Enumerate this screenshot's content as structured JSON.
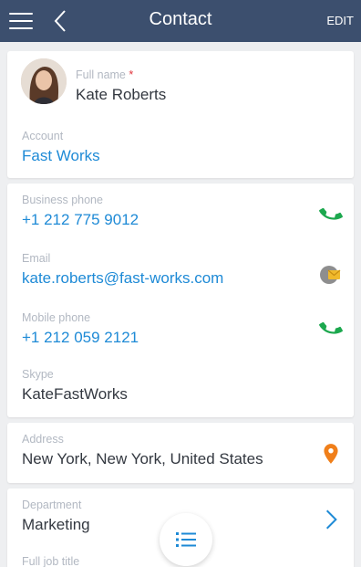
{
  "header": {
    "title": "Contact",
    "edit_label": "EDIT"
  },
  "profile": {
    "full_name_label": "Full name",
    "required_mark": "*",
    "full_name": "Kate Roberts",
    "account_label": "Account",
    "account": "Fast Works"
  },
  "communication": {
    "business_phone_label": "Business phone",
    "business_phone": "+1 212 775 9012",
    "email_label": "Email",
    "email": "kate.roberts@fast-works.com",
    "mobile_phone_label": "Mobile phone",
    "mobile_phone": "+1 212 059 2121",
    "skype_label": "Skype",
    "skype": "KateFastWorks"
  },
  "address": {
    "label": "Address",
    "value": "New York, New York, United States"
  },
  "job": {
    "department_label": "Department",
    "department": "Marketing",
    "full_job_title_label": "Full job title"
  },
  "colors": {
    "header_bg": "#3c4f6e",
    "link": "#1e8ad6",
    "phone_icon": "#1ca84e",
    "address_icon": "#f07f1a",
    "email_icon": "#f0b92c",
    "chevron": "#1e8ad6"
  },
  "icons": {
    "menu": "hamburger-icon",
    "back": "chevron-left-icon",
    "phone": "phone-icon",
    "email": "envelope-icon",
    "address": "map-pin-icon",
    "open": "chevron-right-icon",
    "fab": "list-icon"
  }
}
